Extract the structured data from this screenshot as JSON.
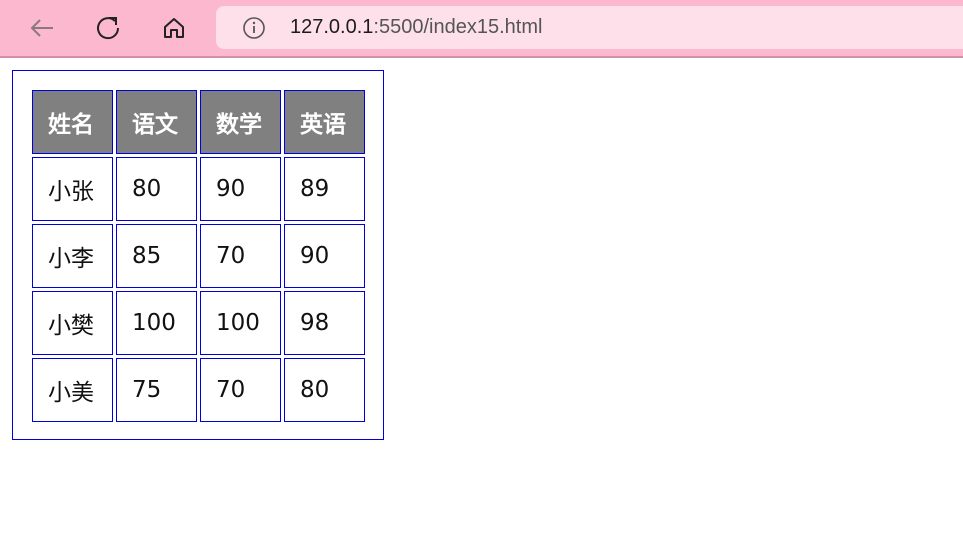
{
  "browser": {
    "url_host": "127.0.0.1",
    "url_rest": ":5500/index15.html",
    "icons": [
      "back-arrow-icon",
      "reload-icon",
      "home-icon",
      "info-icon"
    ]
  },
  "table": {
    "headers": [
      "姓名",
      "语文",
      "数学",
      "英语"
    ],
    "rows": [
      [
        "小张",
        "80",
        "90",
        "89"
      ],
      [
        "小李",
        "85",
        "70",
        "90"
      ],
      [
        "小樊",
        "100",
        "100",
        "98"
      ],
      [
        "小美",
        "75",
        "70",
        "80"
      ]
    ]
  },
  "colors": {
    "toolbar": "#fcb8cf",
    "address_bar": "#fde0ea",
    "table_border": "#0000dd",
    "header_bg": "#808080"
  }
}
